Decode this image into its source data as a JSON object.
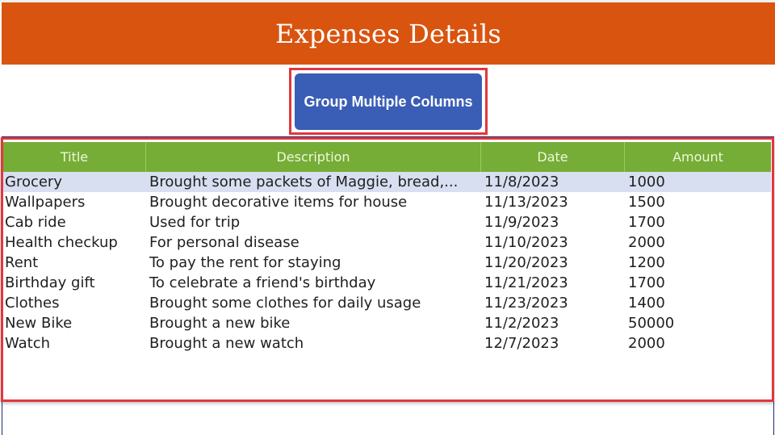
{
  "header": {
    "title": "Expenses Details"
  },
  "toolbar": {
    "group_button_label": "Group Multiple Columns"
  },
  "colors": {
    "header_bg": "#d9540f",
    "button_bg": "#3a5db5",
    "grid_header_bg": "#76ad36",
    "highlight_border": "#e0383e",
    "selected_row_bg": "#d8dff0"
  },
  "grid": {
    "columns": [
      "Title",
      "Description",
      "Date",
      "Amount"
    ],
    "rows": [
      {
        "title": "Grocery",
        "description": "Brought some packets of Maggie, bread,...",
        "date": "11/8/2023",
        "amount": "1000",
        "selected": true
      },
      {
        "title": "Wallpapers",
        "description": "Brought decorative items for house",
        "date": "11/13/2023",
        "amount": "1500"
      },
      {
        "title": "Cab ride",
        "description": "Used for trip",
        "date": "11/9/2023",
        "amount": "1700"
      },
      {
        "title": "Health checkup",
        "description": "For personal disease",
        "date": "11/10/2023",
        "amount": "2000"
      },
      {
        "title": "Rent",
        "description": "To pay the rent for staying",
        "date": "11/20/2023",
        "amount": "1200"
      },
      {
        "title": "Birthday gift",
        "description": "To celebrate a friend's birthday",
        "date": "11/21/2023",
        "amount": "1700"
      },
      {
        "title": "Clothes",
        "description": "Brought some clothes for daily usage",
        "date": "11/23/2023",
        "amount": "1400"
      },
      {
        "title": "New Bike",
        "description": "Brought a new bike",
        "date": "11/2/2023",
        "amount": "50000"
      },
      {
        "title": "Watch",
        "description": "Brought a new watch",
        "date": "12/7/2023",
        "amount": "2000"
      }
    ]
  }
}
